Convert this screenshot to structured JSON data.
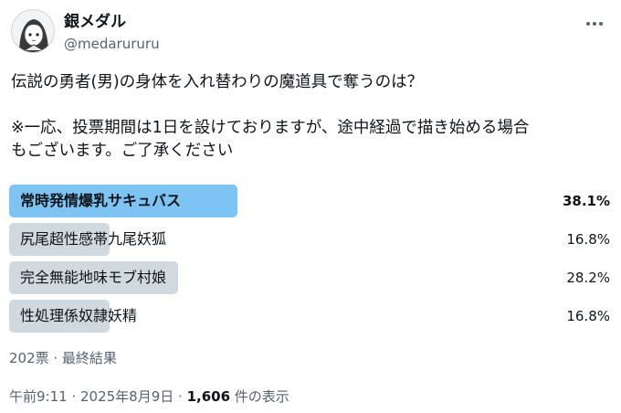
{
  "author": {
    "display_name": "銀メダル",
    "handle": "@medarururu",
    "avatar_icon": "anime-avatar-icon"
  },
  "tweet": {
    "line1": "伝説の勇者(男)の身体を入れ替わりの魔道具で奪うのは？",
    "line2": "※一応、投票期間は1日を設けておりますが、途中経過で描き始める場合",
    "line3": "もございます。ご了承ください"
  },
  "poll": {
    "options": [
      {
        "label": "常時発情爆乳サキュバス",
        "percent_text": "38.1%",
        "percent": 38.1,
        "winner": true
      },
      {
        "label": "尻尾超性感帯九尾妖狐",
        "percent_text": "16.8%",
        "percent": 16.8,
        "winner": false
      },
      {
        "label": "完全無能地味モブ村娘",
        "percent_text": "28.2%",
        "percent": 28.2,
        "winner": false
      },
      {
        "label": "性処理係奴隷妖精",
        "percent_text": "16.8%",
        "percent": 16.8,
        "winner": false
      }
    ],
    "summary": "202票 · 最終結果"
  },
  "meta": {
    "time": "午前9:11 · 2025年8月9日 · ",
    "views_count": "1,606",
    "views_label": " 件の表示"
  },
  "colors": {
    "winner_bar": "#7dc4f5",
    "other_bar": "#cfd9de",
    "secondary_text": "#536471"
  }
}
